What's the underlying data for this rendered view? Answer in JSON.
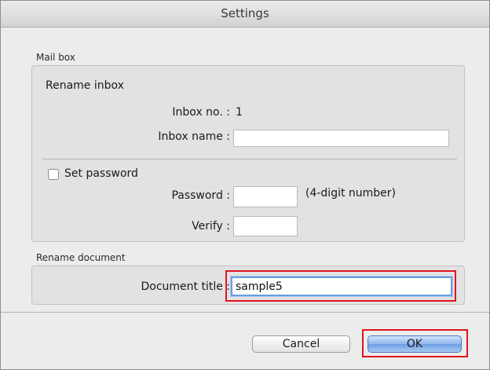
{
  "window": {
    "title": "Settings"
  },
  "mailbox": {
    "group_label": "Mail box",
    "section_title": "Rename inbox",
    "inbox_no_label": "Inbox no. :",
    "inbox_no_value": "1",
    "inbox_name_label": "Inbox name :",
    "inbox_name_value": "",
    "set_password_label": "Set password",
    "set_password_checked": false,
    "password_label": "Password :",
    "password_hint": "(4-digit number)",
    "verify_label": "Verify :"
  },
  "rename_document": {
    "group_label": "Rename document",
    "document_title_label": "Document title :",
    "document_title_value": "sample5"
  },
  "buttons": {
    "cancel": "Cancel",
    "ok": "OK"
  },
  "colors": {
    "highlight": "#e0141e",
    "focus_ring": "#6a9de0",
    "default_button": "#8db6ed"
  }
}
